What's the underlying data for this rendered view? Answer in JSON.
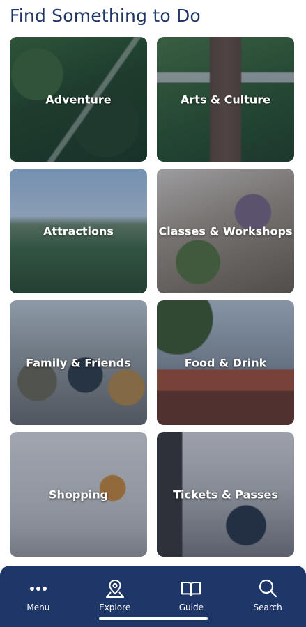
{
  "page": {
    "title": "Find Something to Do"
  },
  "categories": [
    {
      "label": "Adventure"
    },
    {
      "label": "Arts & Culture"
    },
    {
      "label": "Attractions"
    },
    {
      "label": "Classes & Workshops"
    },
    {
      "label": "Family & Friends"
    },
    {
      "label": "Food & Drink"
    },
    {
      "label": "Shopping"
    },
    {
      "label": "Tickets & Passes"
    }
  ],
  "nav": {
    "items": [
      {
        "label": "Menu",
        "icon": "more-dots-icon"
      },
      {
        "label": "Explore",
        "icon": "map-pin-icon",
        "active": true
      },
      {
        "label": "Guide",
        "icon": "open-book-icon"
      },
      {
        "label": "Search",
        "icon": "search-icon"
      }
    ]
  },
  "colors": {
    "navy": "#1f3768",
    "white": "#ffffff"
  }
}
